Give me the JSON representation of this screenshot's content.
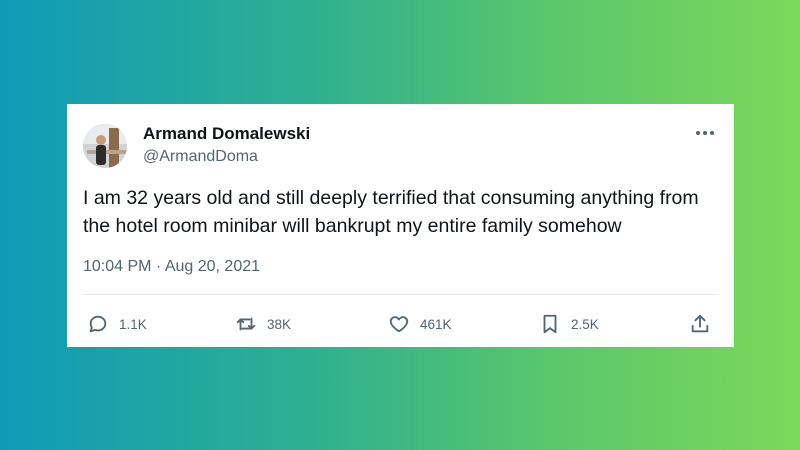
{
  "tweet": {
    "author_name": "Armand Domalewski",
    "author_handle": "@ArmandDoma",
    "text": "I am 32 years old and still deeply terrified that consuming anything from the hotel room minibar will bankrupt my entire family somehow",
    "timestamp": "10:04 PM · Aug 20, 2021",
    "stats": {
      "replies": "1.1K",
      "retweets": "38K",
      "likes": "461K",
      "bookmarks": "2.5K"
    }
  },
  "icons": {
    "reply": "reply-icon",
    "retweet": "retweet-icon",
    "like": "heart-icon",
    "bookmark": "bookmark-icon",
    "share": "share-icon",
    "more": "more-icon"
  },
  "colors": {
    "card_background": "#ffffff",
    "primary_text": "#0f1419",
    "secondary_text": "#536471",
    "gradient_start": "#0f9bb8",
    "gradient_end": "#7bd85a"
  }
}
